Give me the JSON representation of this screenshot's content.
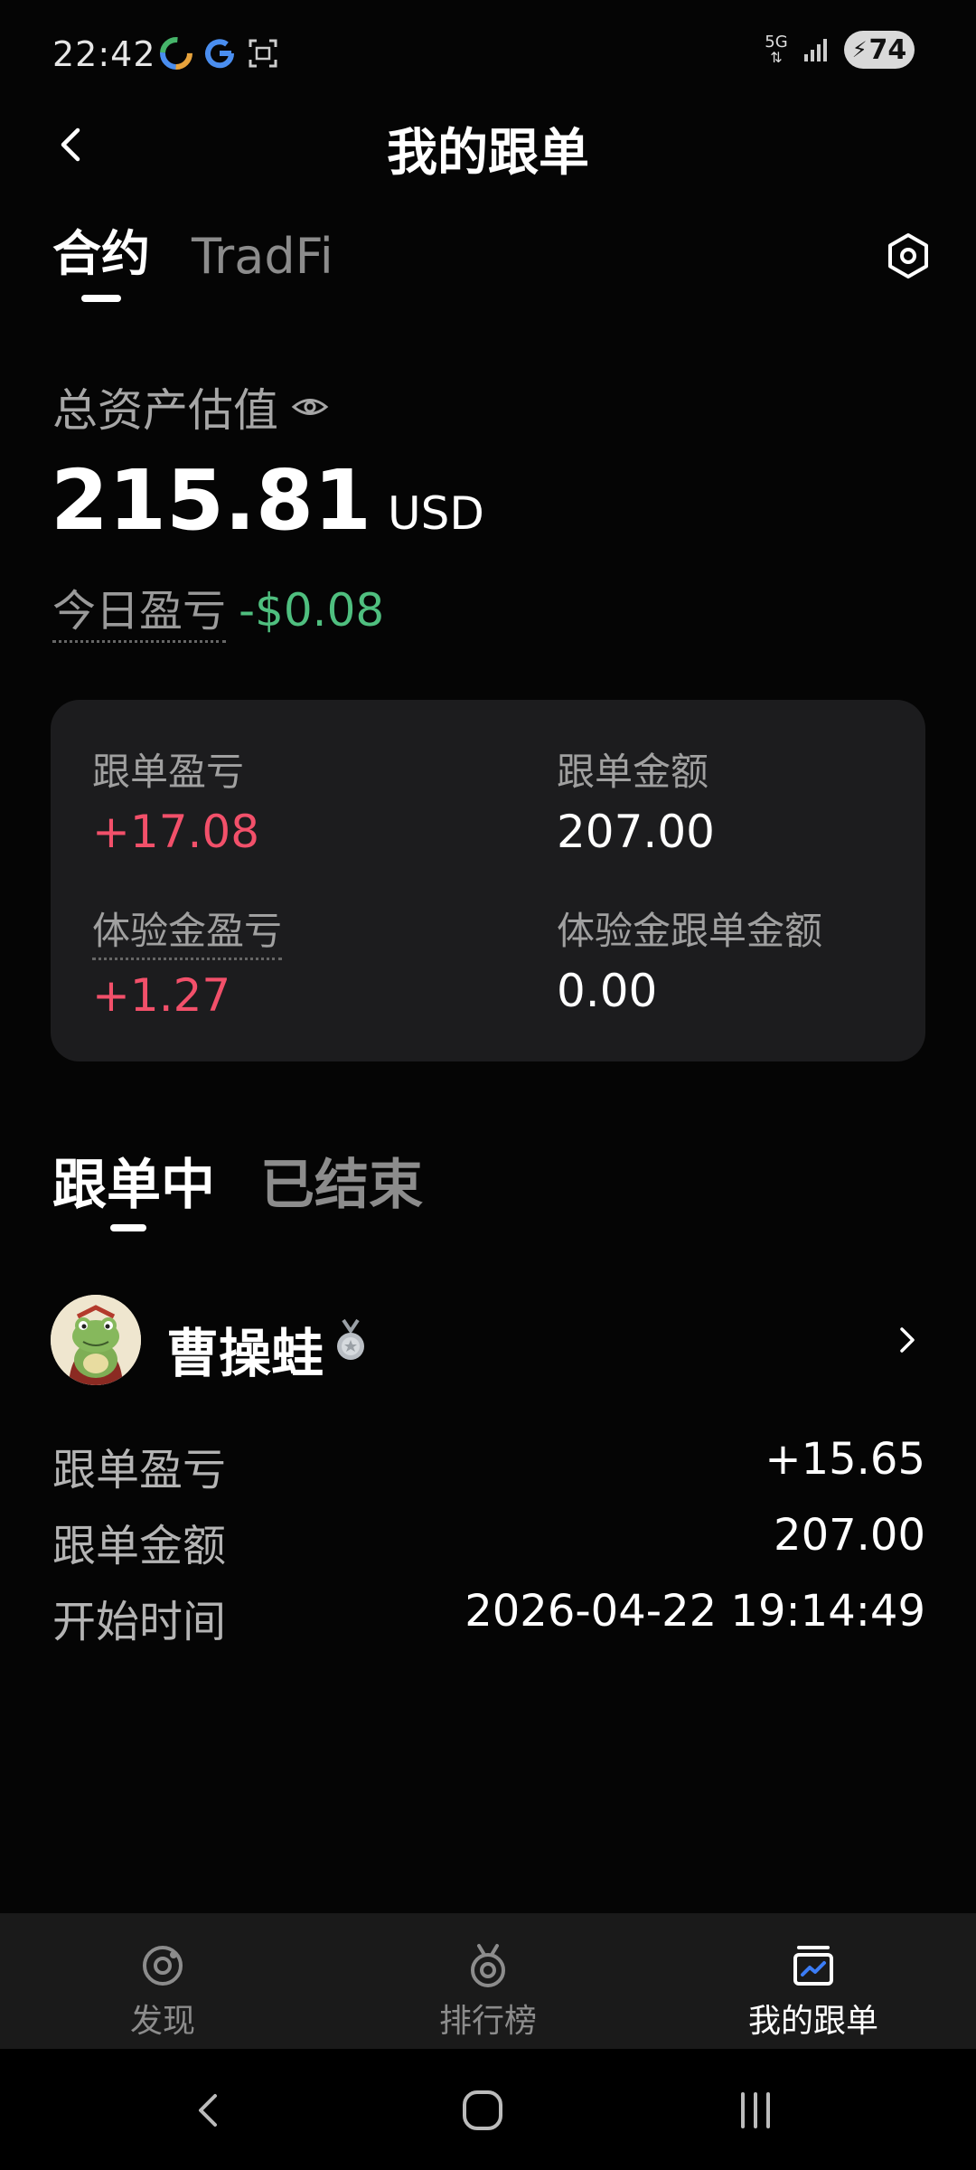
{
  "status_bar": {
    "time": "22:42",
    "network": "5G",
    "battery": "74"
  },
  "header": {
    "title": "我的跟单"
  },
  "top_tabs": [
    {
      "label": "合约",
      "active": true
    },
    {
      "label": "TradFi",
      "active": false
    }
  ],
  "assets": {
    "label": "总资产估值",
    "value": "215.81",
    "unit": "USD",
    "daily_pnl_label": "今日盈亏",
    "daily_pnl_value": "-$0.08"
  },
  "summary": {
    "follow_pnl_label": "跟单盈亏",
    "follow_pnl_value": "+17.08",
    "follow_amount_label": "跟单金额",
    "follow_amount_value": "207.00",
    "trial_pnl_label": "体验金盈亏",
    "trial_pnl_value": "+1.27",
    "trial_amount_label": "体验金跟单金额",
    "trial_amount_value": "0.00"
  },
  "follow_tabs": [
    {
      "label": "跟单中",
      "active": true
    },
    {
      "label": "已结束",
      "active": false
    }
  ],
  "trader": {
    "name": "曹操蛙",
    "rows": [
      {
        "label": "跟单盈亏",
        "value": "+15.65"
      },
      {
        "label": "跟单金额",
        "value": "207.00"
      },
      {
        "label": "开始时间",
        "value": "2026-04-22 19:14:49"
      }
    ]
  },
  "bottom_nav": [
    {
      "label": "发现",
      "icon": "discover-icon"
    },
    {
      "label": "排行榜",
      "icon": "leaderboard-icon"
    },
    {
      "label": "我的跟单",
      "icon": "my-copy-trades-icon"
    }
  ],
  "colors": {
    "positive_red": "#f2506a",
    "negative_green": "#4fbf7f",
    "card_bg": "#1c1c1e"
  }
}
